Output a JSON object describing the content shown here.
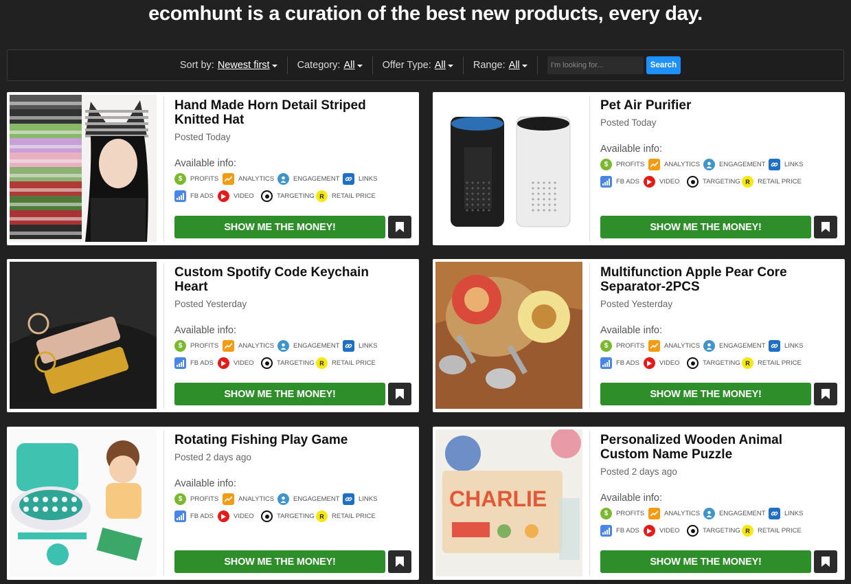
{
  "header": {
    "headline": "ecomhunt is a curation of the best new products, every day."
  },
  "filters": {
    "sort_label": "Sort by:",
    "sort_value": "Newest first",
    "category_label": "Category:",
    "category_value": "All",
    "offer_label": "Offer Type:",
    "offer_value": "All",
    "range_label": "Range:",
    "range_value": "All",
    "search_placeholder": "I'm looking for...",
    "search_button": "Search"
  },
  "labels": {
    "available": "Available info:",
    "profits": "PROFITS",
    "analytics": "ANALYTICS",
    "engagement": "ENGAGEMENT",
    "links": "LINKS",
    "fbads": "FB ADS",
    "video": "VIDEO",
    "targeting": "TARGETING",
    "retail": "RETAIL PRICE",
    "cta": "SHOW ME THE MONEY!",
    "retail_icon": "R"
  },
  "products": [
    {
      "title": "Hand Made Horn Detail Striped Knitted Hat",
      "posted": "Posted Today",
      "image_icon": "knitted-cat-ear-hat"
    },
    {
      "title": "Pet Air Purifier",
      "posted": "Posted Today",
      "image_icon": "air-purifier"
    },
    {
      "title": "Custom Spotify Code Keychain Heart",
      "posted": "Posted Yesterday",
      "image_icon": "keychain"
    },
    {
      "title": "Multifunction Apple Pear Core Separator-2PCS",
      "posted": "Posted Yesterday",
      "image_icon": "apple-corer"
    },
    {
      "title": "Rotating Fishing Play Game",
      "posted": "Posted 2 days ago",
      "image_icon": "fishing-toy"
    },
    {
      "title": "Personalized Wooden Animal Custom Name Puzzle",
      "posted": "Posted 2 days ago",
      "image_icon": "name-puzzle",
      "puzzle_name": "CHARLIE"
    }
  ],
  "colors": {
    "background": "#212121",
    "cta_green": "#2e8f2a",
    "search_blue": "#1e90ff",
    "bookmark_dark": "#2b2b2b"
  }
}
